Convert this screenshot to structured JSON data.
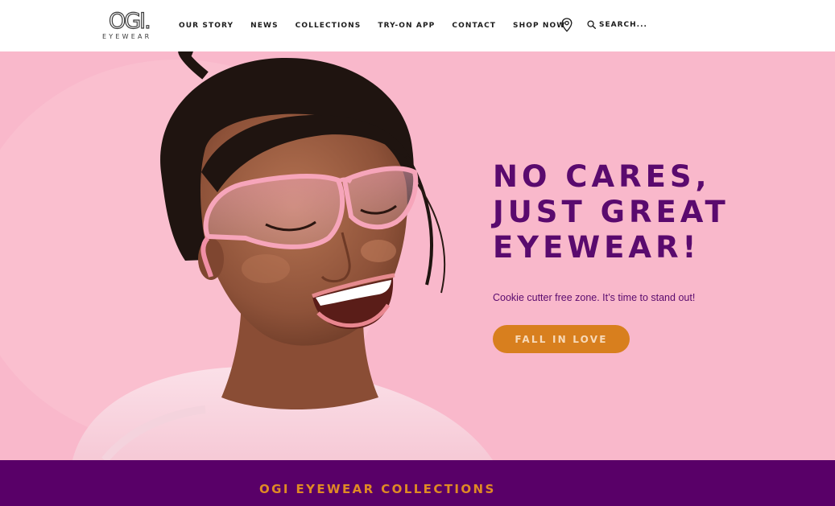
{
  "header": {
    "logo": {
      "mark": "OGI.",
      "sub": "EYEWEAR"
    },
    "nav": [
      {
        "label": "OUR STORY"
      },
      {
        "label": "NEWS"
      },
      {
        "label": "COLLECTIONS"
      },
      {
        "label": "TRY-ON APP"
      },
      {
        "label": "CONTACT"
      },
      {
        "label": "SHOP NOW"
      }
    ],
    "location_icon": "map-pin-icon",
    "search": {
      "icon": "search-icon",
      "placeholder": "SEARCH..."
    }
  },
  "hero": {
    "headline_lines": [
      "NO CARES,",
      "JUST GREAT",
      "EYEWEAR!"
    ],
    "subline": "Cookie cutter free zone. It’s time to stand out!",
    "cta_label": "FALL IN LOVE",
    "colors": {
      "background": "#f9b8cb",
      "headline": "#5a0a6e",
      "cta": "#d87f1e"
    }
  },
  "collections": {
    "title": "OGI EYEWEAR COLLECTIONS",
    "colors": {
      "background": "#590068",
      "title": "#e08a24"
    }
  }
}
